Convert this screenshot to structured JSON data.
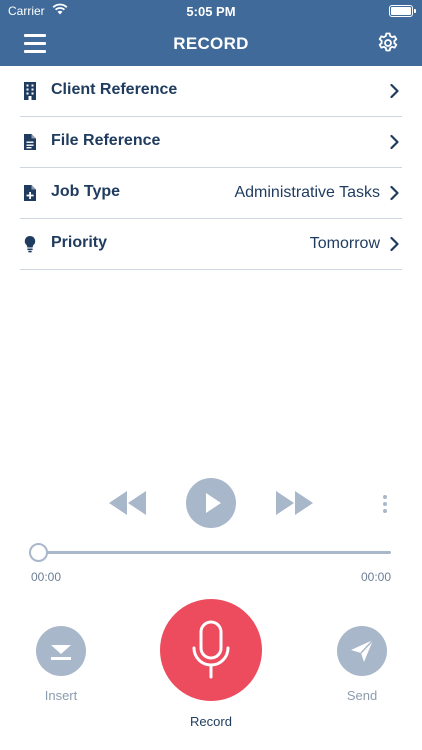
{
  "status_bar": {
    "carrier": "Carrier",
    "time": "5:05 PM"
  },
  "nav": {
    "title": "RECORD",
    "menu_icon": "hamburger-menu-icon",
    "settings_icon": "gear-icon"
  },
  "rows": [
    {
      "icon": "building-icon",
      "label": "Client Reference",
      "value": ""
    },
    {
      "icon": "document-icon",
      "label": "File Reference",
      "value": ""
    },
    {
      "icon": "document-plus-icon",
      "label": "Job Type",
      "value": "Administrative Tasks"
    },
    {
      "icon": "lightbulb-icon",
      "label": "Priority",
      "value": "Tomorrow"
    }
  ],
  "player": {
    "elapsed": "00:00",
    "duration": "00:00",
    "progress_fraction": 0
  },
  "actions": {
    "insert_label": "Insert",
    "record_label": "Record",
    "send_label": "Send"
  },
  "colors": {
    "header": "#3f6a99",
    "text": "#1f3b5e",
    "control": "#a8b7c9",
    "record": "#ec4c5e",
    "divider": "#cfd6df"
  }
}
